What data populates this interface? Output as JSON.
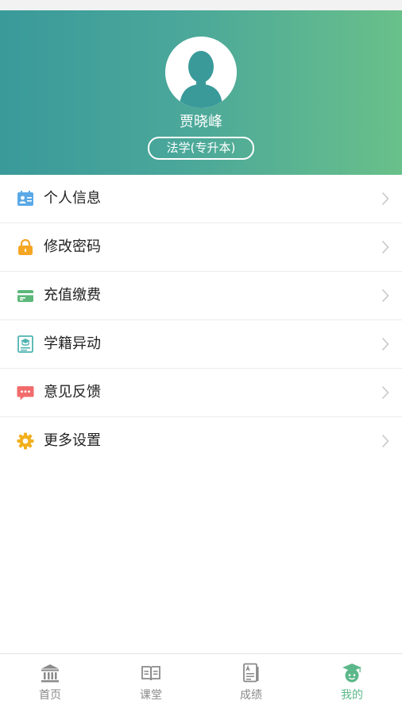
{
  "profile": {
    "name": "贾晓峰",
    "major": "法学(专升本)"
  },
  "menu": [
    {
      "label": "个人信息",
      "icon": "id-card-icon",
      "color": "#5aa9e6"
    },
    {
      "label": "修改密码",
      "icon": "lock-icon",
      "color": "#f5a623"
    },
    {
      "label": "充值缴费",
      "icon": "payment-card-icon",
      "color": "#5cb87a"
    },
    {
      "label": "学籍异动",
      "icon": "student-record-icon",
      "color": "#4fb4b0"
    },
    {
      "label": "意见反馈",
      "icon": "feedback-icon",
      "color": "#f26b6b"
    },
    {
      "label": "更多设置",
      "icon": "gear-icon",
      "color": "#f2b01e"
    }
  ],
  "tabs": [
    {
      "label": "首页",
      "icon": "home-building-icon",
      "active": false
    },
    {
      "label": "课堂",
      "icon": "book-icon",
      "active": false
    },
    {
      "label": "成绩",
      "icon": "grades-document-icon",
      "active": false
    },
    {
      "label": "我的",
      "icon": "graduate-avatar-icon",
      "active": true
    }
  ],
  "colors": {
    "header_gradient_start": "#3a9a9a",
    "header_gradient_end": "#69c08a",
    "active_tab": "#5cb88a",
    "inactive_tab": "#8a8a8a"
  }
}
